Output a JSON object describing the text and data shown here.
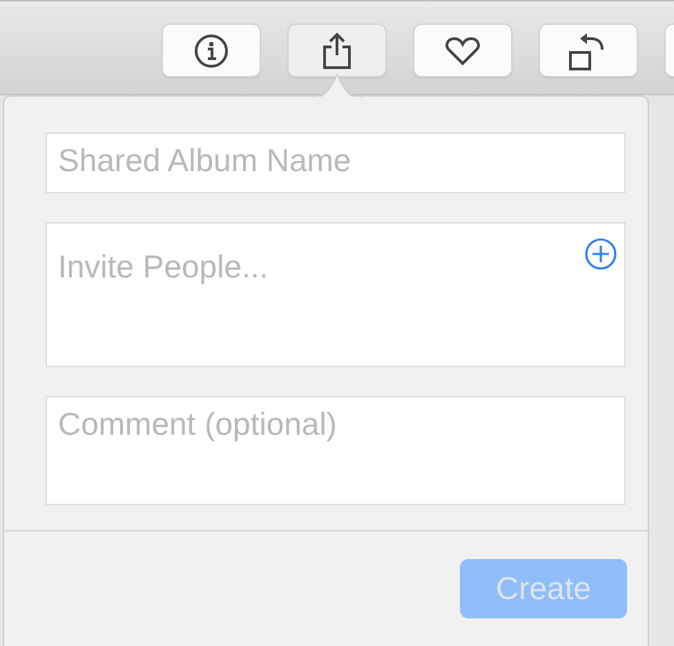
{
  "toolbar_buttons": [
    {
      "kind": "info",
      "selected": false
    },
    {
      "kind": "share",
      "selected": true
    },
    {
      "kind": "heart",
      "selected": false
    },
    {
      "kind": "rotate",
      "selected": false
    },
    {
      "kind": "blank",
      "selected": false
    }
  ],
  "popover": {
    "fields": [
      {
        "kind": "line",
        "placeholder": "Shared Album Name"
      },
      {
        "kind": "invite",
        "placeholder": "Invite People..."
      },
      {
        "kind": "area",
        "placeholder": "Comment (optional)"
      }
    ],
    "create_button": {
      "label": "Create",
      "disabled": true
    }
  }
}
